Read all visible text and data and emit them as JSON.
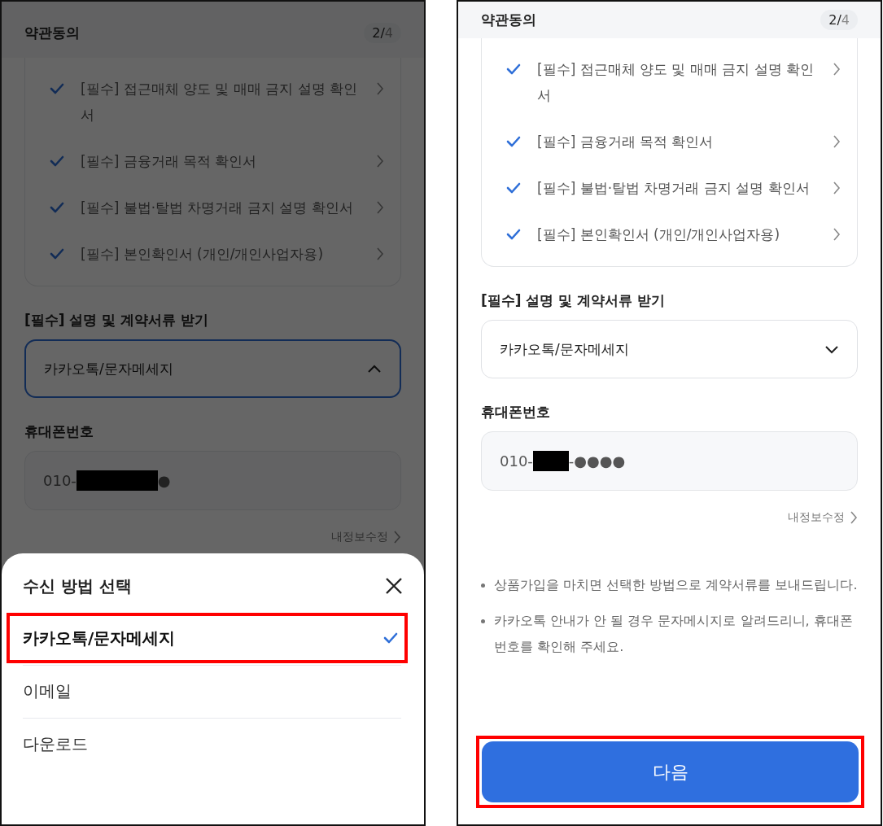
{
  "screens": [
    {
      "kind": "dimmed",
      "header": {
        "title": "약관동의",
        "step": "2/",
        "total": "4"
      },
      "agreements": [
        {
          "label": "[필수] 접근매체 양도 및 매매 금지 설명 확인서",
          "checked": true
        },
        {
          "label": "[필수] 금융거래 목적 확인서",
          "checked": true
        },
        {
          "label": "[필수] 불법·탈법 차명거래 금지 설명 확인서",
          "checked": true
        },
        {
          "label": "[필수] 본인확인서 (개인/개인사업자용)",
          "checked": true
        }
      ],
      "receive": {
        "label": "[필수] 설명 및 계약서류 받기",
        "value": "카카오톡/문자메세지",
        "expanded": true
      },
      "phone": {
        "label": "휴대폰번호",
        "prefix": "010-",
        "suffix": "●"
      },
      "edit_link": "내정보수정",
      "sheet": {
        "title": "수신 방법 선택",
        "options": [
          {
            "label": "카카오톡/문자메세지",
            "selected": true,
            "highlighted": true
          },
          {
            "label": "이메일",
            "selected": false,
            "highlighted": false
          },
          {
            "label": "다운로드",
            "selected": false,
            "highlighted": false
          }
        ]
      }
    },
    {
      "kind": "normal",
      "header": {
        "title": "약관동의",
        "step": "2/",
        "total": "4"
      },
      "agreements": [
        {
          "label": "[필수] 접근매체 양도 및 매매 금지 설명 확인서",
          "checked": true
        },
        {
          "label": "[필수] 금융거래 목적 확인서",
          "checked": true
        },
        {
          "label": "[필수] 불법·탈법 차명거래 금지 설명 확인서",
          "checked": true
        },
        {
          "label": "[필수] 본인확인서 (개인/개인사업자용)",
          "checked": true
        }
      ],
      "receive": {
        "label": "[필수] 설명 및 계약서류 받기",
        "value": "카카오톡/문자메세지",
        "expanded": false
      },
      "phone": {
        "label": "휴대폰번호",
        "prefix": "010-",
        "suffix": "-●●●●"
      },
      "edit_link": "내정보수정",
      "notes": [
        "상품가입을 마치면 선택한 방법으로 계약서류를 보내드립니다.",
        "카카오톡 안내가 안 될 경우 문자메시지로 알려드리니, 휴대폰번호를 확인해 주세요."
      ],
      "next_button": {
        "label": "다음",
        "highlighted": true
      }
    }
  ]
}
